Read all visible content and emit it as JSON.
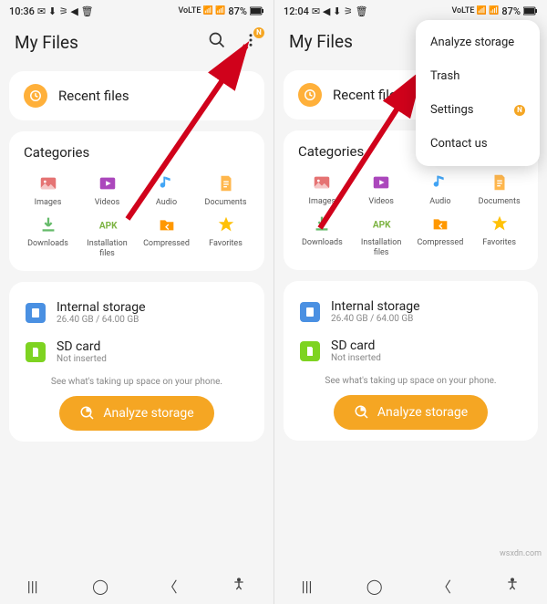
{
  "left": {
    "status": {
      "time": "10:36",
      "battery": "87%"
    },
    "header": {
      "title": "My Files"
    },
    "recent": {
      "label": "Recent files"
    },
    "categories": {
      "title": "Categories",
      "items": [
        "Images",
        "Videos",
        "Audio",
        "Documents",
        "Downloads",
        "Installation files",
        "Compressed",
        "Favorites"
      ]
    },
    "storage": {
      "internal": {
        "name": "Internal storage",
        "sub": "26.40 GB / 64.00 GB"
      },
      "sdcard": {
        "name": "SD card",
        "sub": "Not inserted"
      },
      "hint": "See what's taking up space on your phone.",
      "analyze": "Analyze storage"
    }
  },
  "right": {
    "status": {
      "time": "12:04",
      "battery": "87%"
    },
    "header": {
      "title": "My Files"
    },
    "recent": {
      "label": "Recent files"
    },
    "categories": {
      "title": "Categories",
      "items": [
        "Images",
        "Videos",
        "Audio",
        "Documents",
        "Downloads",
        "Installation files",
        "Compressed",
        "Favorites"
      ]
    },
    "storage": {
      "internal": {
        "name": "Internal storage",
        "sub": "26.40 GB / 64.00 GB"
      },
      "sdcard": {
        "name": "SD card",
        "sub": "Not inserted"
      },
      "hint": "See what's taking up space on your phone.",
      "analyze": "Analyze storage"
    },
    "popup": {
      "items": [
        "Analyze storage",
        "Trash",
        "Settings",
        "Contact us"
      ],
      "badgeIndex": 2
    }
  },
  "watermark": "wsxdn.com"
}
